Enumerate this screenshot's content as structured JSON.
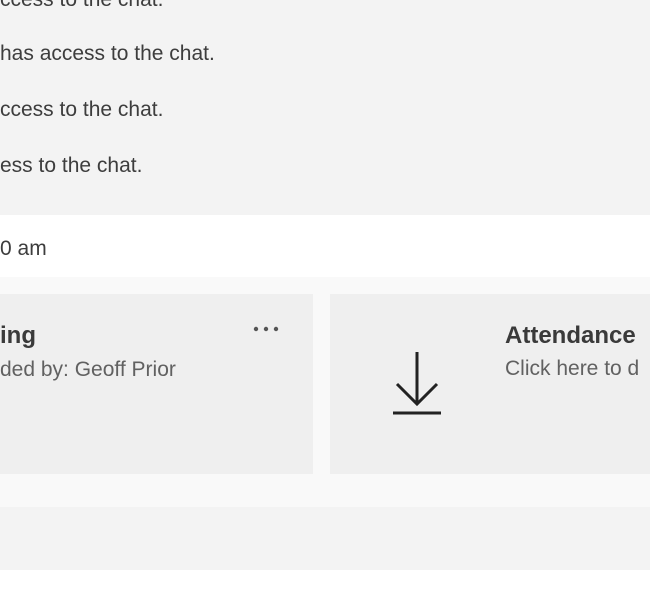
{
  "system_messages": [
    "ccess to the chat.",
    "has access to the chat.",
    "ccess to the chat.",
    "ess to the chat."
  ],
  "timestamp": "0 am",
  "recording_card": {
    "title": "ing",
    "subtitle": "ded by: Geoff Prior",
    "more_icon": "more-options-icon"
  },
  "attendance_card": {
    "title": "Attendance",
    "subtitle": "Click here to d",
    "icon": "download-icon"
  }
}
